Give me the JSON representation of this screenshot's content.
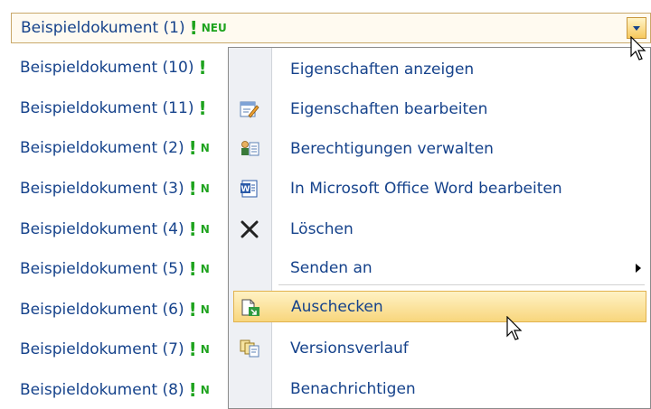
{
  "documents": [
    {
      "name": "Beispieldokument (1)",
      "badge": "NEU"
    },
    {
      "name": "Beispieldokument (10)",
      "badge": ""
    },
    {
      "name": "Beispieldokument (11)",
      "badge": ""
    },
    {
      "name": "Beispieldokument (2)",
      "badge": "N"
    },
    {
      "name": "Beispieldokument (3)",
      "badge": "N"
    },
    {
      "name": "Beispieldokument (4)",
      "badge": "N"
    },
    {
      "name": "Beispieldokument (5)",
      "badge": "N"
    },
    {
      "name": "Beispieldokument (6)",
      "badge": "N"
    },
    {
      "name": "Beispieldokument (7)",
      "badge": "N"
    },
    {
      "name": "Beispieldokument (8)",
      "badge": "N"
    }
  ],
  "exclamation": "!",
  "menu": {
    "items": [
      {
        "label": "Eigenschaften anzeigen",
        "icon": "none"
      },
      {
        "label": "Eigenschaften bearbeiten",
        "icon": "edit-properties-icon"
      },
      {
        "label": "Berechtigungen verwalten",
        "icon": "permissions-icon"
      },
      {
        "label": "In Microsoft Office Word bearbeiten",
        "icon": "word-icon"
      },
      {
        "label": "Löschen",
        "icon": "delete-icon"
      },
      {
        "label": "Senden an",
        "icon": "none",
        "submenu": true
      },
      {
        "label": "Auschecken",
        "icon": "checkout-icon",
        "highlighted": true
      },
      {
        "label": "Versionsverlauf",
        "icon": "version-history-icon"
      },
      {
        "label": "Benachrichtigen",
        "icon": "none"
      }
    ]
  },
  "colors": {
    "link": "#15428b",
    "new_badge": "#1ea31e",
    "highlight": "#f8d67d"
  }
}
